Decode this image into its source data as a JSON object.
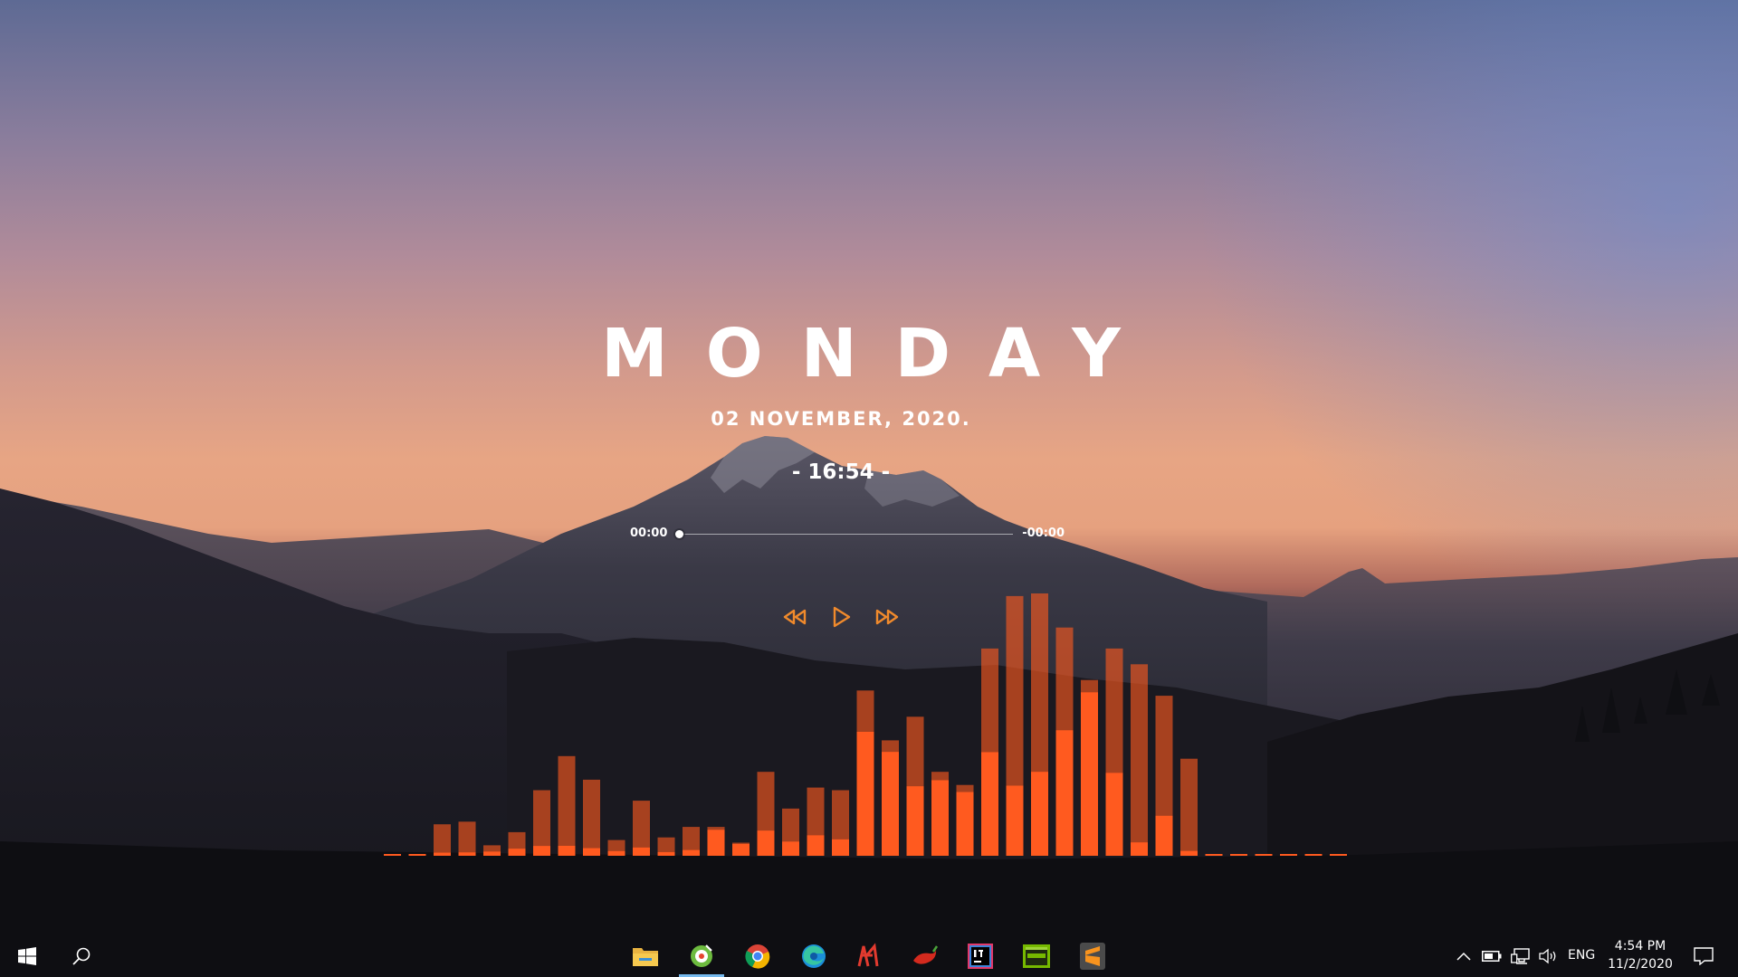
{
  "widget": {
    "day": "MONDAY",
    "date": "02 NOVEMBER, 2020.",
    "clock": "- 16:54 -",
    "elapsed": "00:00",
    "remaining": "-00:00",
    "progress": 0,
    "controls": {
      "previous_icon": "rewind-icon",
      "play_icon": "play-icon",
      "next_icon": "fast-forward-icon",
      "accent_color": "#f08a2c"
    }
  },
  "visualizer": {
    "bar_color": "#ff5a1f",
    "bar_levels": [
      0.0,
      0.0,
      0.12,
      0.13,
      0.04,
      0.09,
      0.25,
      0.38,
      0.29,
      0.06,
      0.21,
      0.07,
      0.11,
      0.11,
      0.05,
      0.32,
      0.18,
      0.26,
      0.25,
      0.63,
      0.44,
      0.53,
      0.32,
      0.27,
      0.79,
      0.99,
      1.0,
      0.87,
      0.67,
      0.79,
      0.73,
      0.61,
      0.37,
      0.0,
      0.0,
      0.0,
      0.0,
      0.0,
      0.0
    ],
    "bar_fill": [
      0,
      0,
      0.1,
      0.1,
      0.4,
      0.3,
      0.15,
      0.1,
      0.1,
      0.3,
      0.15,
      0.2,
      0.2,
      0.9,
      0.9,
      0.3,
      0.3,
      0.3,
      0.25,
      0.75,
      0.9,
      0.5,
      0.9,
      0.9,
      0.5,
      0.27,
      0.32,
      0.55,
      0.93,
      0.4,
      0.07,
      0.25,
      0.05,
      0,
      0,
      0,
      0,
      0,
      0
    ]
  },
  "taskbar": {
    "start_icon": "windows-start-icon",
    "search_icon": "search-icon",
    "apps": [
      {
        "name": "file-explorer-icon",
        "label": ""
      },
      {
        "name": "music-player-icon",
        "label": ""
      },
      {
        "name": "chrome-icon",
        "label": ""
      },
      {
        "name": "edge-icon",
        "label": ""
      },
      {
        "name": "rainmeter-icon",
        "label": ""
      },
      {
        "name": "chili-app-icon",
        "label": ""
      },
      {
        "name": "intellij-idea-icon",
        "label": ""
      },
      {
        "name": "nvidia-icon",
        "label": ""
      },
      {
        "name": "sublime-text-icon",
        "label": ""
      }
    ],
    "tray": {
      "chevron_icon": "chevron-up-icon",
      "battery_icon": "battery-icon",
      "network_icon": "network-icon",
      "volume_icon": "volume-icon",
      "language": "ENG",
      "time": "4:54 PM",
      "date": "11/2/2020",
      "notifications_icon": "notification-icon"
    }
  }
}
